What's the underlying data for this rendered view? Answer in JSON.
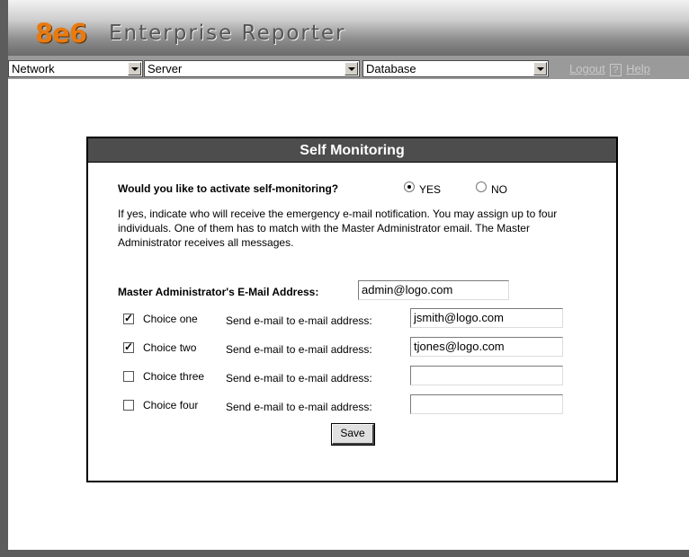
{
  "header": {
    "logo": "8e6",
    "app_title": "Enterprise Reporter"
  },
  "nav": {
    "network": "Network",
    "server": "Server",
    "database": "Database",
    "logout": "Logout",
    "help_icon": "?",
    "help": "Help"
  },
  "panel": {
    "title": "Self Monitoring",
    "question": "Would you like to activate self-monitoring?",
    "yes_label": "YES",
    "no_label": "NO",
    "selected": "YES",
    "info": "If yes, indicate who will receive the emergency e-mail notification. You may assign up to four individuals. One of them has to match with the Master Administrator email. The Master Administrator receives all messages.",
    "master_label": "Master Administrator's E-Mail Address:",
    "master_email": "admin@logo.com",
    "send_label": "Send e-mail to e-mail address:",
    "choices": [
      {
        "label": "Choice one",
        "checked": true,
        "email": "jsmith@logo.com"
      },
      {
        "label": "Choice two",
        "checked": true,
        "email": "tjones@logo.com"
      },
      {
        "label": "Choice three",
        "checked": false,
        "email": ""
      },
      {
        "label": "Choice four",
        "checked": false,
        "email": ""
      }
    ],
    "save_label": "Save"
  }
}
